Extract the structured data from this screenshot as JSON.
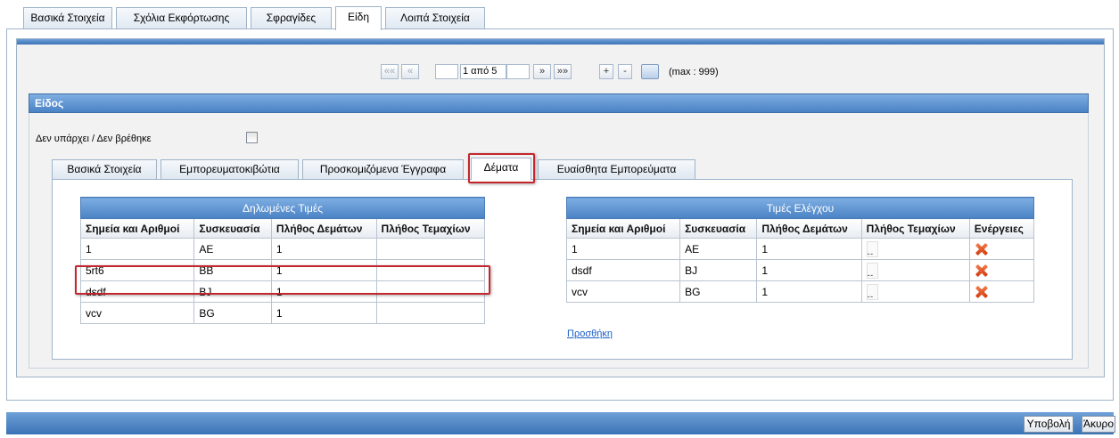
{
  "top_tabs": [
    {
      "label": "Βασικά Στοιχεία"
    },
    {
      "label": "Σχόλια Εκφόρτωσης"
    },
    {
      "label": "Σφραγίδες"
    },
    {
      "label": "Είδη"
    },
    {
      "label": "Λοιπά Στοιχεία"
    }
  ],
  "pager": {
    "first": "««",
    "prev": "«",
    "page_value": "1 από 5",
    "next": "»",
    "last": "»»",
    "add": "+",
    "remove": "-",
    "max_label": "(max : 999)"
  },
  "section": {
    "title": "Είδος",
    "not_found_label": "Δεν υπάρχει / Δεν βρέθηκε"
  },
  "inner_tabs": [
    {
      "label": "Βασικά Στοιχεία"
    },
    {
      "label": "Εμπορευματοκιβώτια"
    },
    {
      "label": "Προσκομιζόμενα Έγγραφα"
    },
    {
      "label": "Δέματα"
    },
    {
      "label": "Ευαίσθητα Εμπορεύματα"
    }
  ],
  "declared": {
    "caption": "Δηλωμένες Τιμές",
    "columns": [
      "Σημεία και Αριθμοί",
      "Συσκευασία",
      "Πλήθος Δεμάτων",
      "Πλήθος Τεμαχίων"
    ],
    "rows": [
      [
        "1",
        "AE",
        "1",
        ""
      ],
      [
        "5rt6",
        "BB",
        "1",
        ""
      ],
      [
        "dsdf",
        "BJ",
        "1",
        ""
      ],
      [
        "vcv",
        "BG",
        "1",
        ""
      ]
    ]
  },
  "control": {
    "caption": "Τιμές Ελέγχου",
    "columns": [
      "Σημεία και Αριθμοί",
      "Συσκευασία",
      "Πλήθος Δεμάτων",
      "Πλήθος Τεμαχίων",
      "Ενέργειες"
    ],
    "rows": [
      [
        "1",
        "AE",
        "1"
      ],
      [
        "dsdf",
        "BJ",
        "1"
      ],
      [
        "vcv",
        "BG",
        "1"
      ]
    ],
    "add_link": "Προσθήκη"
  },
  "footer": {
    "submit": "Υποβολή",
    "cancel": "Άκυρο"
  },
  "colors": {
    "accent_blue": "#4a82c4",
    "highlight_red": "#c4262e",
    "delete_icon": "#e0501f"
  }
}
